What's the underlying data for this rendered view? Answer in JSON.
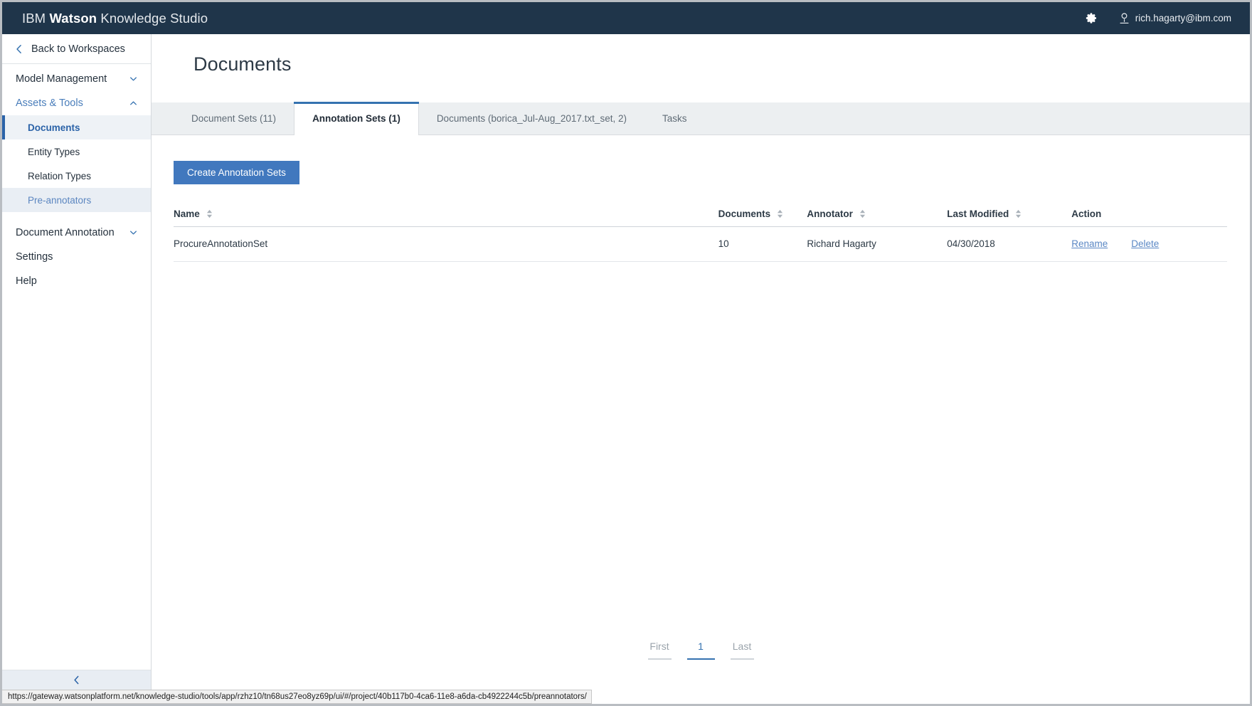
{
  "header": {
    "brand_prefix": "IBM ",
    "brand_bold": "Watson",
    "brand_suffix": " Knowledge Studio",
    "gear_icon": "gear-icon",
    "user_icon": "user-icon",
    "user_email": "rich.hagarty@ibm.com",
    "background_color": "#1f354a"
  },
  "sidebar": {
    "back_label": "Back to Workspaces",
    "back_icon": "chevron-left-icon",
    "groups": [
      {
        "label": "Model Management",
        "caret": "chevron-down-icon",
        "expanded": false
      },
      {
        "label": "Assets & Tools",
        "caret": "chevron-up-icon",
        "expanded": true
      }
    ],
    "sub_items": [
      {
        "label": "Documents",
        "state": "active"
      },
      {
        "label": "Entity Types",
        "state": "normal"
      },
      {
        "label": "Relation Types",
        "state": "normal"
      },
      {
        "label": "Pre-annotators",
        "state": "hovered"
      }
    ],
    "lower_groups": [
      {
        "label": "Document Annotation",
        "caret": "chevron-down-icon"
      }
    ],
    "items": [
      {
        "label": "Settings"
      },
      {
        "label": "Help"
      }
    ],
    "collapse_icon": "chevron-left-icon",
    "accent_color": "#2b63a8"
  },
  "main": {
    "page_title": "Documents",
    "tabs": [
      {
        "label": "Document Sets (11)",
        "active": false
      },
      {
        "label": "Annotation Sets (1)",
        "active": true
      },
      {
        "label": "Documents (borica_Jul-Aug_2017.txt_set, 2)",
        "active": false
      },
      {
        "label": "Tasks",
        "active": false
      }
    ],
    "create_button_label": "Create Annotation Sets",
    "create_button_color": "#4178be",
    "table": {
      "columns": [
        {
          "label": "Name",
          "sortable": true
        },
        {
          "label": "Documents",
          "sortable": true
        },
        {
          "label": "Annotator",
          "sortable": true
        },
        {
          "label": "Last Modified",
          "sortable": true
        },
        {
          "label": "Action",
          "sortable": false
        }
      ],
      "rows": [
        {
          "name": "ProcureAnnotationSet",
          "documents": "10",
          "annotator": "Richard Hagarty",
          "last_modified": "04/30/2018",
          "action_rename": "Rename",
          "action_delete": "Delete"
        }
      ]
    },
    "pagination": {
      "first_label": "First",
      "current_page": "1",
      "last_label": "Last"
    }
  },
  "statusbar": {
    "url": "https://gateway.watsonplatform.net/knowledge-studio/tools/app/rzhz10/tn68us27eo8yz69p/ui/#/project/40b117b0-4ca6-11e8-a6da-cb4922244c5b/preannotators/"
  }
}
